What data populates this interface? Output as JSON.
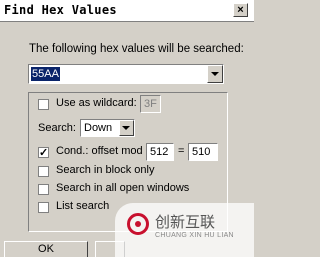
{
  "window": {
    "title": "Find Hex Values",
    "close_label": "×"
  },
  "caption": "The following hex values will be searched:",
  "search_value": "55AA",
  "options": {
    "wildcard": {
      "label": "Use as wildcard:",
      "value": "3F",
      "checked": false
    },
    "search": {
      "label": "Search:",
      "direction": "Down"
    },
    "cond_offset": {
      "label": "Cond.: offset mod",
      "mod": "512",
      "eq_sign": "=",
      "remainder": "510",
      "checked": true
    },
    "block_only": {
      "label": "Search in block only",
      "checked": false
    },
    "all_windows": {
      "label": "Search in all open windows",
      "checked": false
    },
    "list_search": {
      "label": "List search",
      "checked": false
    }
  },
  "buttons": {
    "ok": "OK"
  },
  "watermark": {
    "brand": "创新互联",
    "sub": "CHUANG XIN HU LIAN"
  }
}
